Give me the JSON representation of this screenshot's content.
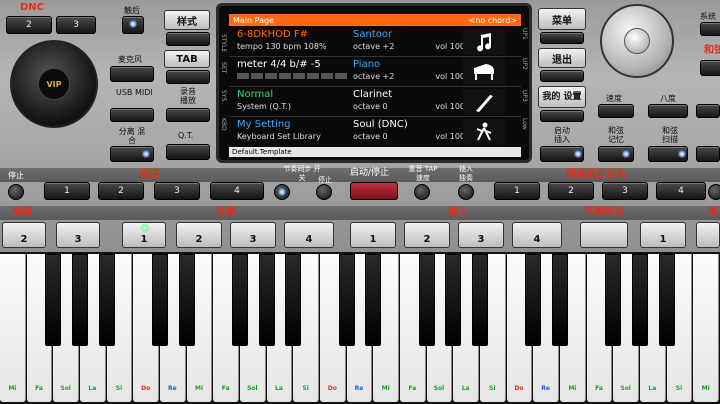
{
  "top_left": {
    "dnc_label": "DNC",
    "dnc_btn1": "2",
    "dnc_btn2": "3",
    "dnc_minus": "-",
    "dnc_plus": "+",
    "tap_label": "触后",
    "vip_label": "VIP",
    "mic_label": "麦克风",
    "usb_label": "USB MIDI",
    "split_label": "分离 混合"
  },
  "side_buttons": {
    "style": "样式",
    "tab": "TAB",
    "record": "录音 播放",
    "qt": "Q.T."
  },
  "lcd": {
    "header_left": "Main Page",
    "header_right": "<no chord>",
    "rows": [
      {
        "l1": "6-8DKHOD F#",
        "l2": "tempo 130 bpm   108%",
        "r1": "Santoor",
        "r2": "octave +2",
        "r3": "vol 100",
        "icon": "music-note-icon"
      },
      {
        "l1": "meter 4/4    b/# -5",
        "l2": "",
        "r1": "Piano",
        "r2": "octave +2",
        "r3": "vol 100",
        "icon": "piano-icon"
      },
      {
        "l1": "Normal",
        "l2": "System (Q.T.)",
        "r1": "Clarinet",
        "r2": "octave  0",
        "r3": "vol 100",
        "icon": "clarinet-icon"
      },
      {
        "l1": "My Setting",
        "l2": "Keyboard Set Library",
        "r1": "Soul (DNC)",
        "r2": "octave  0",
        "r3": "vol 100",
        "icon": "dancer-icon"
      }
    ],
    "footer": "Default.Template",
    "side_labels": [
      "STYLE",
      "SET",
      "SYS",
      "KBD"
    ],
    "right_labels": [
      "UP1",
      "UP2",
      "UP3",
      "Low"
    ]
  },
  "right_menu": {
    "menu": "菜单",
    "exit": "退出",
    "my_setting": "我的 设置",
    "start_insert": "启动 插入",
    "system": "系统",
    "chord_label": "和弦",
    "speed": "速度",
    "octave": "八度",
    "chord_memory": "和弦 记忆",
    "chord_scan": "和弦 扫描"
  },
  "middle_row": {
    "stop": "停止",
    "bass_label": "铺底",
    "variation": "节奏同步 开关",
    "variation2": "停止",
    "start_stop": "启动/停止",
    "tap": "重音 TAP 速度",
    "fill": "插入 独奏",
    "kbd_combo": "键盘组合音色",
    "buttons": [
      "1",
      "2",
      "3",
      "4"
    ],
    "combo_buttons": [
      "1",
      "2",
      "3",
      "4"
    ]
  },
  "bottom_row": {
    "intro": "前奏",
    "variation": "变奏",
    "insert": "插入",
    "rhythm_break": "节奏断点",
    "ending": "尾",
    "intro_btns": [
      "2",
      "3",
      "1"
    ],
    "variation_btns": [
      "2",
      "3",
      "4"
    ],
    "insert_btns": [
      "1",
      "2",
      "3",
      "4"
    ],
    "break_btns": [
      "1"
    ]
  },
  "keyboard": {
    "white_notes": [
      "Mi",
      "Fa",
      "Sol",
      "La",
      "Si",
      "Do",
      "Re",
      "Mi",
      "Fa",
      "Sol",
      "La",
      "Si",
      "Do",
      "Re",
      "Mi",
      "Fa",
      "Sol",
      "La",
      "Si",
      "Do",
      "Re",
      "Mi",
      "Fa",
      "Sol",
      "La",
      "Si",
      "Mi"
    ],
    "note_colors": {
      "Do": "#e0301e",
      "Re": "#1e60e0",
      "Mi": "#20a020",
      "Fa": "#20a020",
      "Sol": "#20a020",
      "La": "#20a020",
      "Si": "#20a020"
    }
  },
  "colors": {
    "accent_orange": "#ff6a10",
    "label_red": "#e03020",
    "lcd_green": "#2ee06a",
    "lcd_blue": "#38a8ff",
    "lcd_orange": "#ff6a10"
  }
}
